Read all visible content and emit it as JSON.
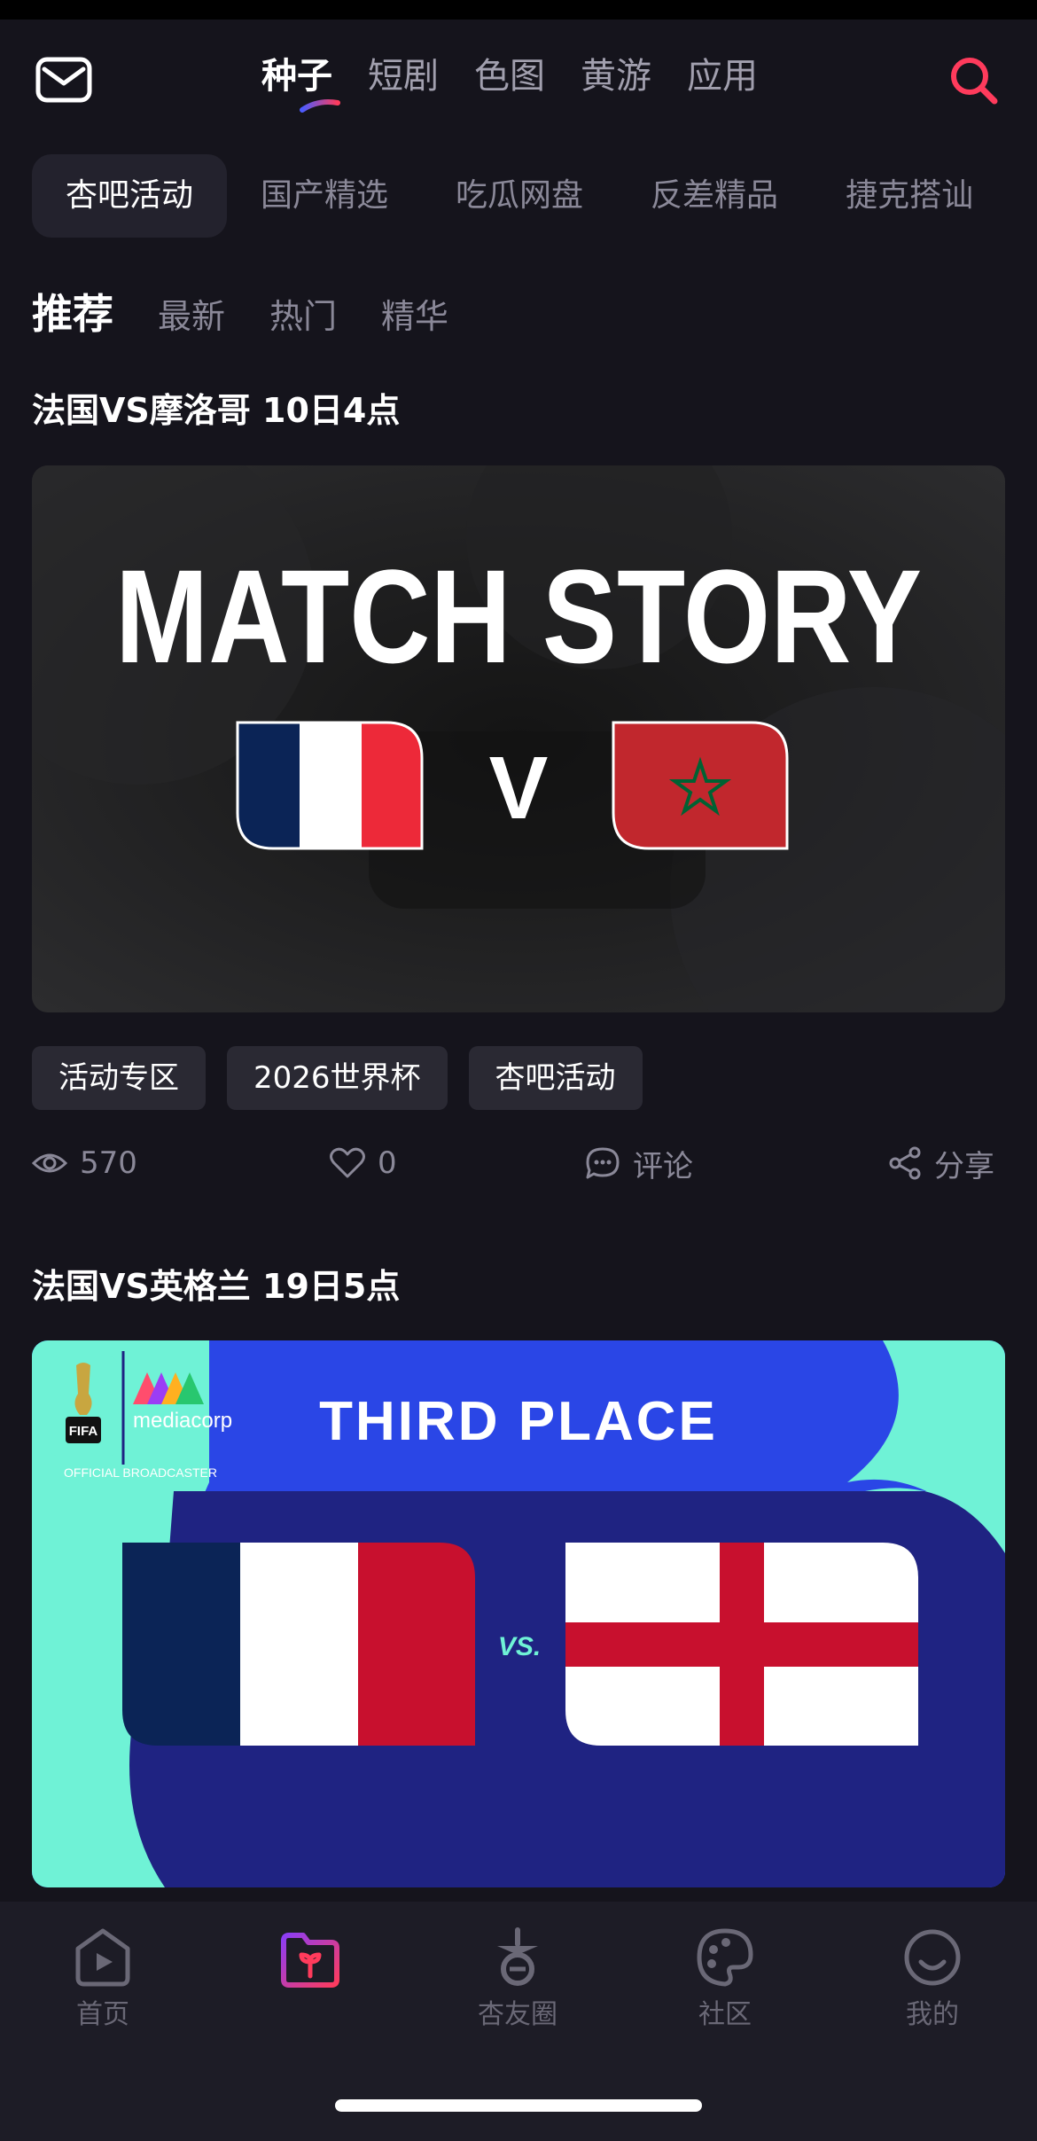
{
  "header": {
    "mail_icon": "mail-icon",
    "search_icon": "search-icon",
    "tabs": [
      {
        "label": "种子",
        "active": true
      },
      {
        "label": "短剧"
      },
      {
        "label": "色图"
      },
      {
        "label": "黄游"
      },
      {
        "label": "应用"
      }
    ],
    "accent": "#ff3b5c"
  },
  "categories": [
    "杏吧活动",
    "国产精选",
    "吃瓜网盘",
    "反差精品",
    "捷克搭讪"
  ],
  "subtabs": [
    "推荐",
    "最新",
    "热门",
    "精华"
  ],
  "posts": [
    {
      "title": "法国VS摩洛哥   10日4点",
      "cover": {
        "headline": "MATCH STORY",
        "vs": "V"
      },
      "tags": [
        "活动专区",
        "2026世界杯",
        "杏吧活动"
      ],
      "views": "570",
      "likes": "0",
      "comment_label": "评论",
      "share_label": "分享"
    },
    {
      "title": "法国VS英格兰 19日5点",
      "cover": {
        "fifa_label": "FIFA",
        "broadcaster": "mediacorp",
        "broadcaster_note": "OFFICIAL BROADCASTER",
        "headline": "THIRD PLACE",
        "vs": "VS."
      }
    }
  ],
  "bottom_nav": [
    {
      "label": "首页",
      "icon": "home-play-icon"
    },
    {
      "label": "",
      "icon": "sprout-folder-icon",
      "active": true
    },
    {
      "label": "杏友圈",
      "icon": "apricot-icon"
    },
    {
      "label": "社区",
      "icon": "palette-icon"
    },
    {
      "label": "我的",
      "icon": "smile-icon"
    }
  ]
}
